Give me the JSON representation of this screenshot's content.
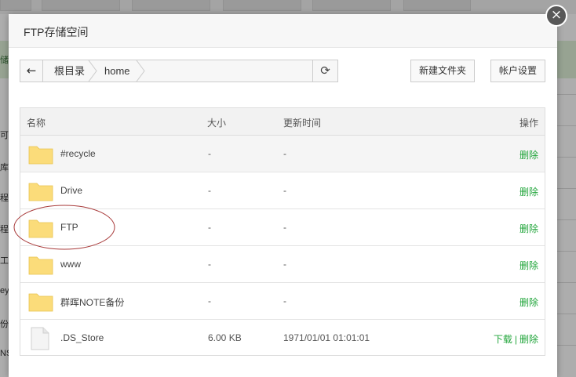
{
  "dialog": {
    "title": "FTP存储空间",
    "close_icon": "×"
  },
  "toolbar": {
    "back_icon": "←",
    "breadcrumb": [
      "根目录",
      "home"
    ],
    "refresh_icon": "⟳",
    "new_folder_label": "新建文件夹",
    "account_settings_label": "帐户设置"
  },
  "table": {
    "headers": {
      "name": "名称",
      "size": "大小",
      "mtime": "更新时间",
      "ops": "操作"
    },
    "rows": [
      {
        "type": "folder",
        "name": "#recycle",
        "size": "-",
        "mtime": "-",
        "ops": [
          "删除"
        ]
      },
      {
        "type": "folder",
        "name": "Drive",
        "size": "-",
        "mtime": "-",
        "ops": [
          "删除"
        ]
      },
      {
        "type": "folder",
        "name": "FTP",
        "size": "-",
        "mtime": "-",
        "ops": [
          "删除"
        ]
      },
      {
        "type": "folder",
        "name": "www",
        "size": "-",
        "mtime": "-",
        "ops": [
          "删除"
        ]
      },
      {
        "type": "folder",
        "name": "群晖NOTE备份",
        "size": "-",
        "mtime": "-",
        "ops": [
          "删除"
        ]
      },
      {
        "type": "file",
        "name": ".DS_Store",
        "size": "6.00 KB",
        "mtime": "1971/01/01 01:01:01",
        "ops": [
          "下载",
          "删除"
        ]
      }
    ],
    "op_separator": "|"
  },
  "background": {
    "row_labels": [
      "储",
      "可",
      "库",
      "程",
      "程",
      "工",
      "ey",
      "份",
      "NS"
    ]
  },
  "colors": {
    "accent_green": "#20a53a",
    "folder_yellow": "#fbdc7a",
    "close_bg": "#585858"
  }
}
